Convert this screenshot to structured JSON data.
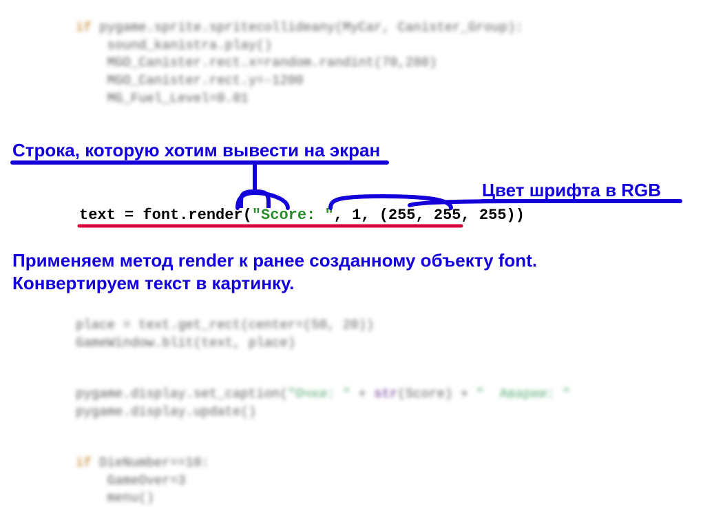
{
  "code": {
    "top": {
      "l1_if": "if",
      "l1_rest": " pygame.sprite.spritecollideany(MyCar, Canister_Group):",
      "l2": "    sound_kanistra.play()",
      "l3": "    MGO_Canister.rect.x=random.randint(70,280)",
      "l4": "    MGO_Canister.rect.y=-1200",
      "l5": "    MG_Fuel_Level=0.01"
    },
    "render": {
      "assign": "text = font.render",
      "open": "(",
      "string": "\"Score: \"",
      "comma1": ", ",
      "antialias": "1",
      "comma2": ", ",
      "rgb_open": "(",
      "rgb": "255, 255, 255",
      "rgb_close": ")",
      "close": ")"
    },
    "mid": {
      "l1": "place = text.get_rect(center=(50, 20))",
      "l2": "GameWindow.blit(text, place)"
    },
    "mid2": {
      "l1a": "pygame.display.set_caption(",
      "l1s1": "\"Очки: \"",
      "l1b": " + ",
      "l1str": "str",
      "l1c": "(Score) + ",
      "l1s2": "\"  Аварии: \"",
      "l2": "pygame.display.update()"
    },
    "bot": {
      "l1_if": "if",
      "l1_rest": " DieNumber==10:",
      "l2": "    GameOver=3",
      "l3": "    menu()"
    }
  },
  "annotations": {
    "string_label": "Строка, которую хотим вывести на экран",
    "rgb_label": "Цвет шрифта в RGB",
    "explain_l1": "Применяем метод render к ранее созданному объекту font.",
    "explain_l2": "Конвертируем текст в картинку."
  }
}
